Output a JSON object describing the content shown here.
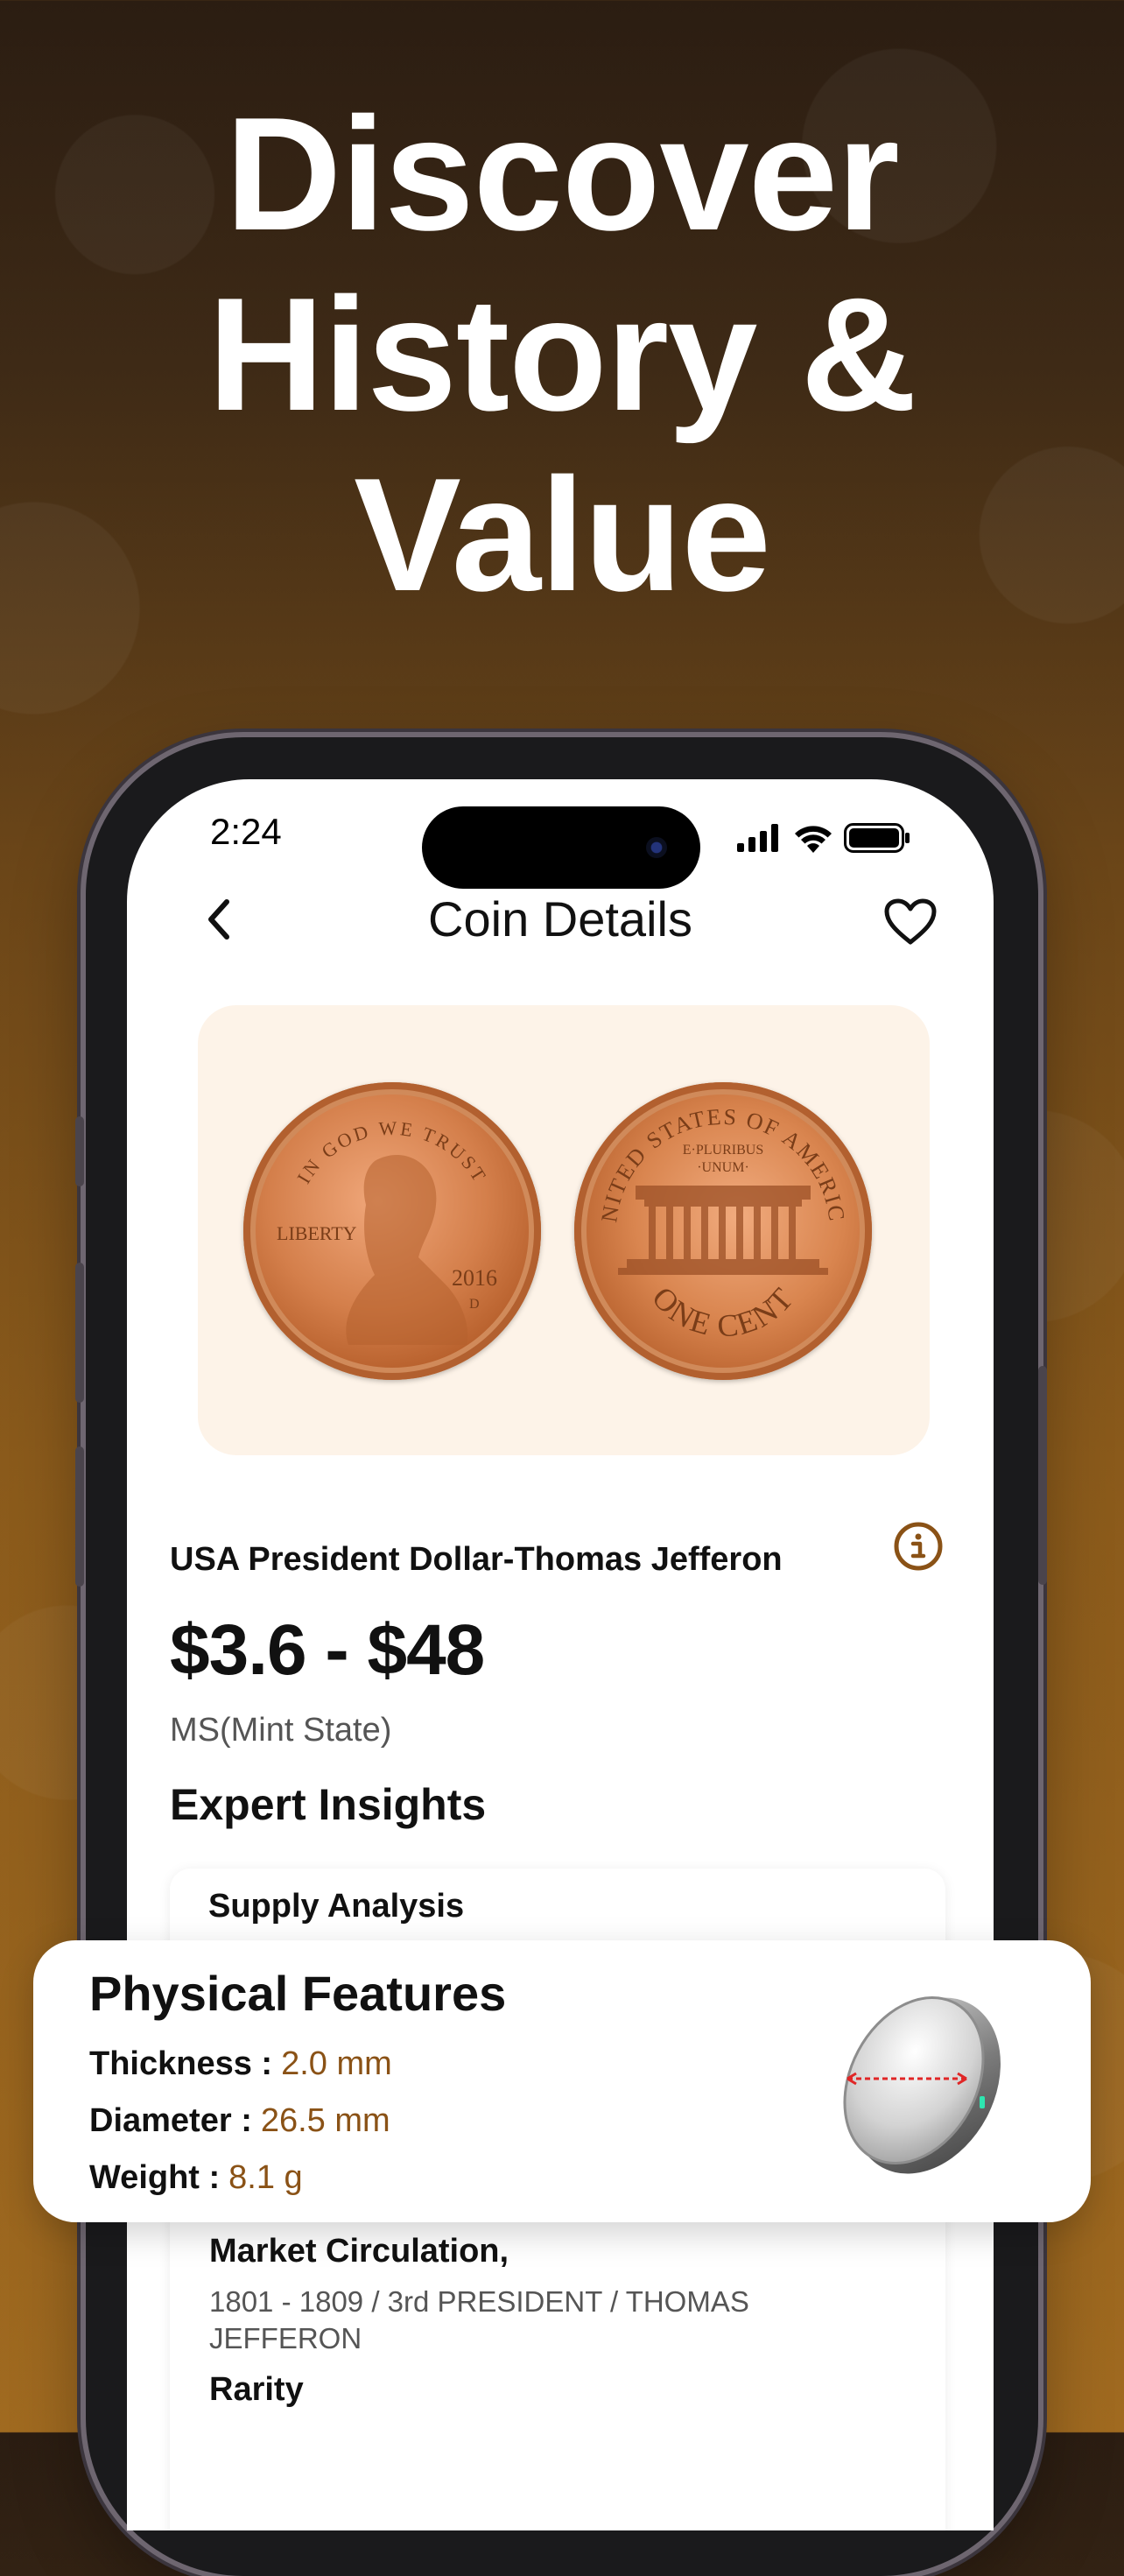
{
  "headline": {
    "line1": "Discover",
    "line2": "History &",
    "line3": "Value"
  },
  "status_bar": {
    "time": "2:24"
  },
  "nav": {
    "title": "Coin Details"
  },
  "coin_images": {
    "obverse": {
      "top_text": "IN GOD WE TRUST",
      "left_text": "LIBERTY",
      "year": "2016",
      "mint_mark": "D"
    },
    "reverse": {
      "top_text": "UNITED STATES OF AMERICA",
      "motto_line1": "E·PLURIBUS",
      "motto_line2": "·UNUM·",
      "denomination": "ONE CENT"
    }
  },
  "coin": {
    "name": "USA President Dollar-Thomas Jefferon",
    "price_range": "$3.6 - $48",
    "grade": "MS(Mint State)"
  },
  "insights": {
    "section_title": "Expert Insights",
    "supply_label": "Supply Analysis",
    "market_label": "Market Circulation,",
    "market_value": "1801 - 1809 / 3rd PRESIDENT / THOMAS JEFFERON",
    "rarity_label": "Rarity"
  },
  "physical_features": {
    "title": "Physical Features",
    "thickness_label": "Thickness :",
    "thickness_value": "2.0 mm",
    "diameter_label": "Diameter :",
    "diameter_value": "26.5 mm",
    "weight_label": "Weight :",
    "weight_value": "8.1 g"
  },
  "icons": [
    "back-chevron-icon",
    "heart-icon",
    "info-icon",
    "signal-icon",
    "wifi-icon",
    "battery-icon",
    "coin-3d-icon"
  ],
  "colors": {
    "accent_brown": "#8a5216",
    "card_peach": "#fdf3e8",
    "copper": "#c8743f"
  }
}
